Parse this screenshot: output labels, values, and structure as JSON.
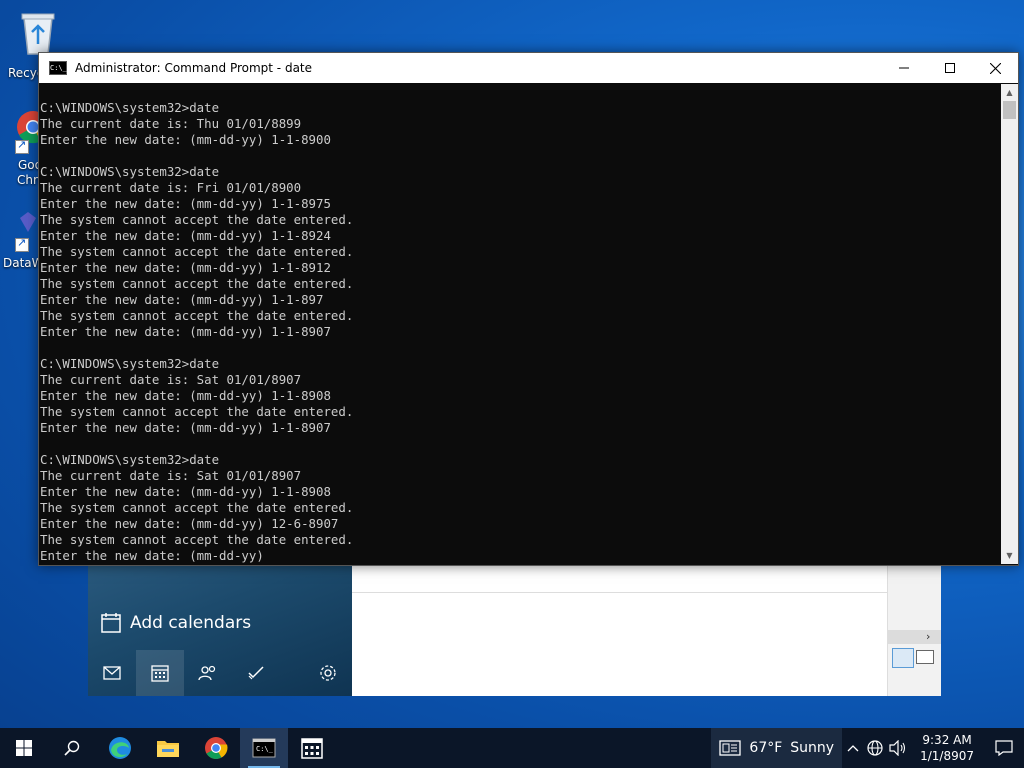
{
  "desktop": {
    "icons": [
      {
        "name": "recycle-bin",
        "label": "Recyc"
      },
      {
        "name": "google-chrome",
        "label1": "Goo",
        "label2": "Chro"
      },
      {
        "name": "dataw",
        "label": "DataW"
      }
    ]
  },
  "mail_app": {
    "add_calendars": "Add calendars",
    "nav_icons": [
      "mail-icon",
      "calendar-icon",
      "people-icon",
      "todo-icon",
      "settings-icon"
    ]
  },
  "cmd": {
    "title": "Administrator: Command Prompt - date",
    "icon_text": "C:\\_",
    "lines": [
      "",
      "C:\\WINDOWS\\system32>date",
      "The current date is: Thu 01/01/8899",
      "Enter the new date: (mm-dd-yy) 1-1-8900",
      "",
      "C:\\WINDOWS\\system32>date",
      "The current date is: Fri 01/01/8900",
      "Enter the new date: (mm-dd-yy) 1-1-8975",
      "The system cannot accept the date entered.",
      "Enter the new date: (mm-dd-yy) 1-1-8924",
      "The system cannot accept the date entered.",
      "Enter the new date: (mm-dd-yy) 1-1-8912",
      "The system cannot accept the date entered.",
      "Enter the new date: (mm-dd-yy) 1-1-897",
      "The system cannot accept the date entered.",
      "Enter the new date: (mm-dd-yy) 1-1-8907",
      "",
      "C:\\WINDOWS\\system32>date",
      "The current date is: Sat 01/01/8907",
      "Enter the new date: (mm-dd-yy) 1-1-8908",
      "The system cannot accept the date entered.",
      "Enter the new date: (mm-dd-yy) 1-1-8907",
      "",
      "C:\\WINDOWS\\system32>date",
      "The current date is: Sat 01/01/8907",
      "Enter the new date: (mm-dd-yy) 1-1-8908",
      "The system cannot accept the date entered.",
      "Enter the new date: (mm-dd-yy) 12-6-8907",
      "The system cannot accept the date entered.",
      "Enter the new date: (mm-dd-yy)"
    ]
  },
  "taskbar": {
    "weather_temp": "67°F",
    "weather_cond": "Sunny",
    "time": "9:32 AM",
    "date": "1/1/8907"
  },
  "colors": {
    "console_bg": "#0c0c0c",
    "console_text": "#cccccc",
    "taskbar_bg": "#0b1628"
  }
}
